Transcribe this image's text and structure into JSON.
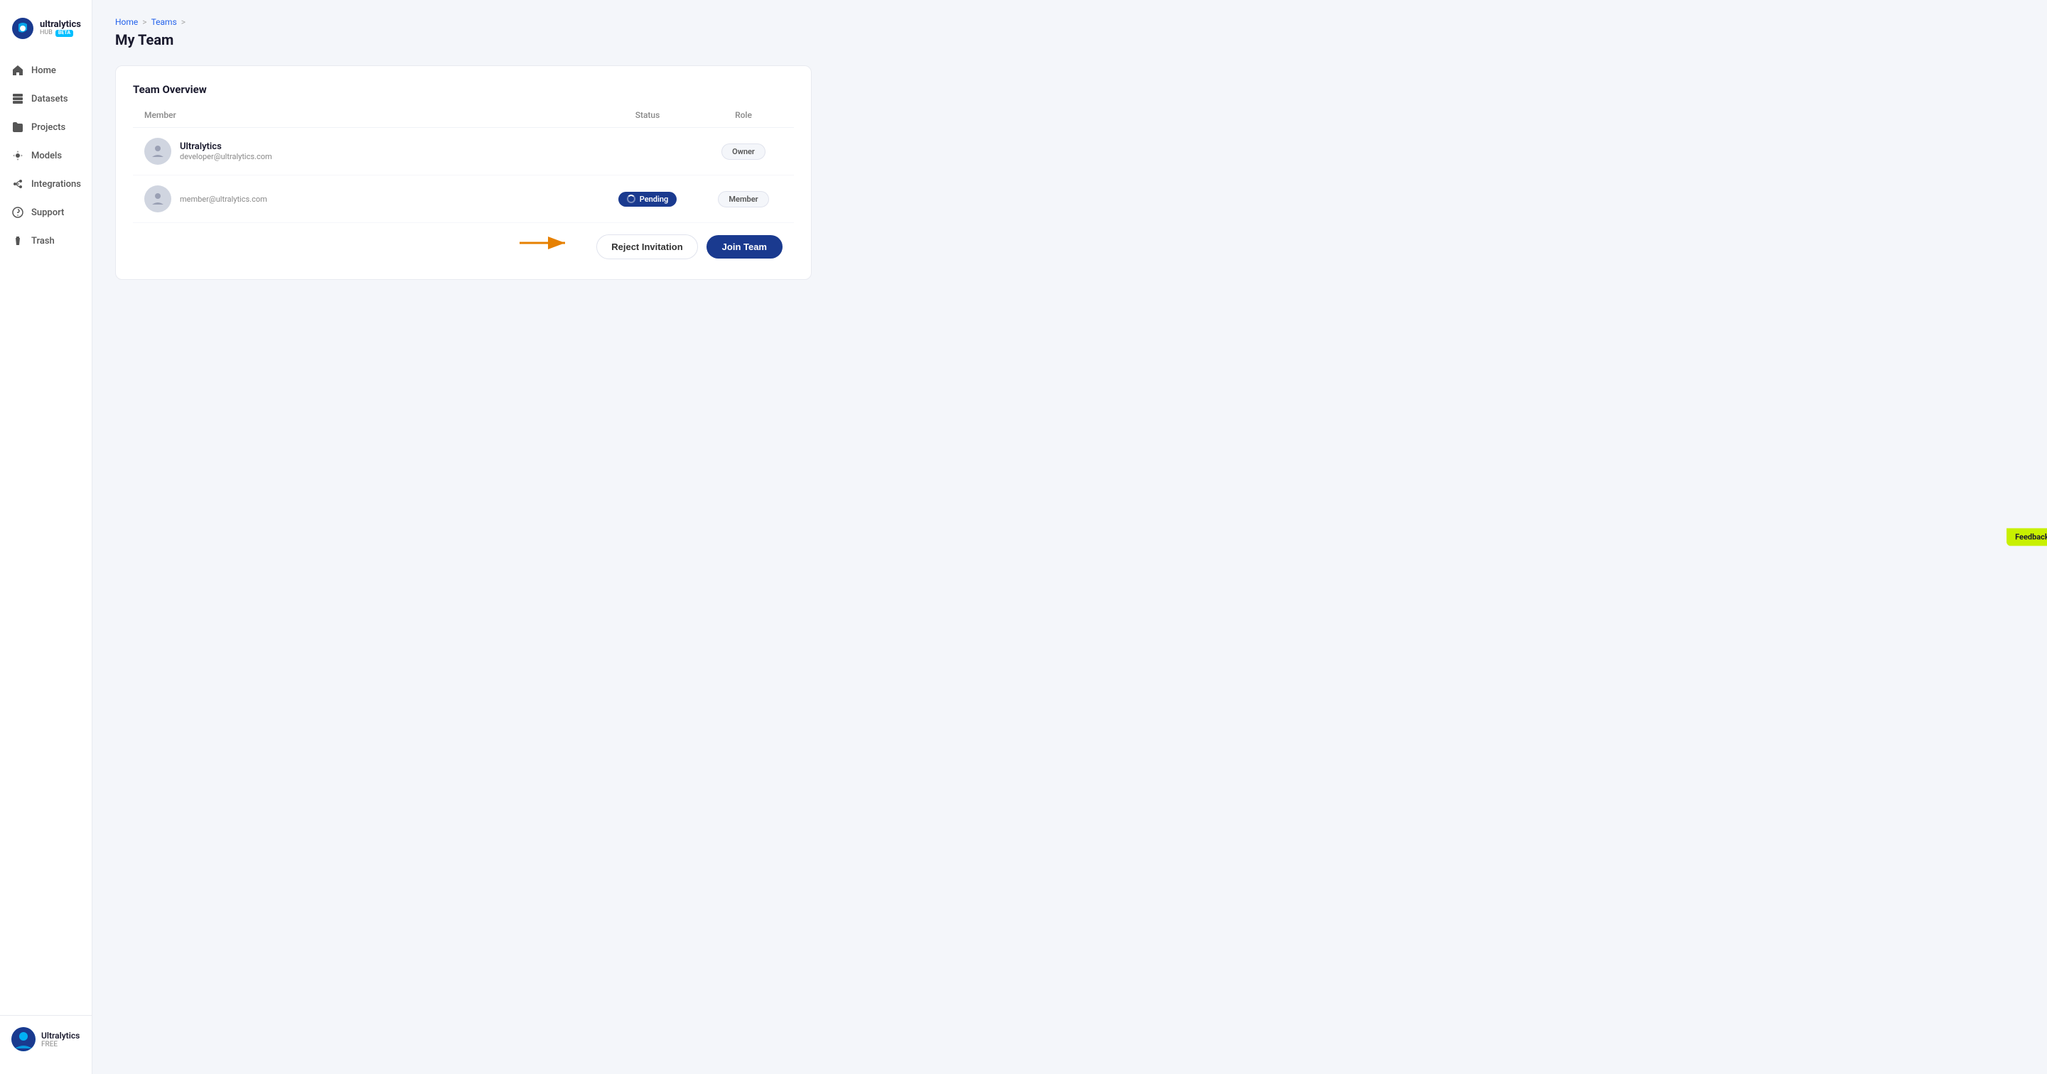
{
  "sidebar": {
    "brand": "ultralytics",
    "hub_label": "HUB",
    "beta_label": "BETA",
    "nav_items": [
      {
        "id": "home",
        "label": "Home",
        "icon": "home"
      },
      {
        "id": "datasets",
        "label": "Datasets",
        "icon": "datasets"
      },
      {
        "id": "projects",
        "label": "Projects",
        "icon": "projects"
      },
      {
        "id": "models",
        "label": "Models",
        "icon": "models"
      },
      {
        "id": "integrations",
        "label": "Integrations",
        "icon": "integrations"
      },
      {
        "id": "support",
        "label": "Support",
        "icon": "support"
      },
      {
        "id": "trash",
        "label": "Trash",
        "icon": "trash"
      }
    ],
    "user": {
      "name": "Ultralytics",
      "plan": "FREE"
    }
  },
  "breadcrumb": {
    "home": "Home",
    "teams": "Teams",
    "current": "My Team"
  },
  "page": {
    "title": "My Team"
  },
  "card": {
    "title": "Team Overview",
    "columns": {
      "member": "Member",
      "status": "Status",
      "role": "Role"
    },
    "members": [
      {
        "name": "Ultralytics",
        "email": "developer@ultralytics.com",
        "status": "",
        "role": "Owner"
      },
      {
        "name": "",
        "email": "member@ultralytics.com",
        "status": "Pending",
        "role": "Member"
      }
    ],
    "actions": {
      "reject_label": "Reject Invitation",
      "join_label": "Join Team"
    }
  },
  "feedback": {
    "label": "Feedback"
  }
}
